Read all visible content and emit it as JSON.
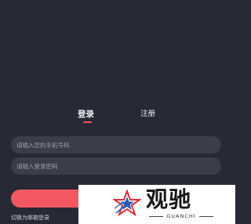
{
  "tabs": {
    "login": "登录",
    "register": "注册"
  },
  "form": {
    "phone_placeholder": "请输入您的手机号码",
    "password_placeholder": "请输入登录密码"
  },
  "switch_link": "切换为邮箱登录",
  "watermark": {
    "title": "观驰",
    "subtitle": "GUANCHI"
  },
  "colors": {
    "background": "#272a35",
    "accent": "#f5515f",
    "field": "#3b3e4a"
  }
}
